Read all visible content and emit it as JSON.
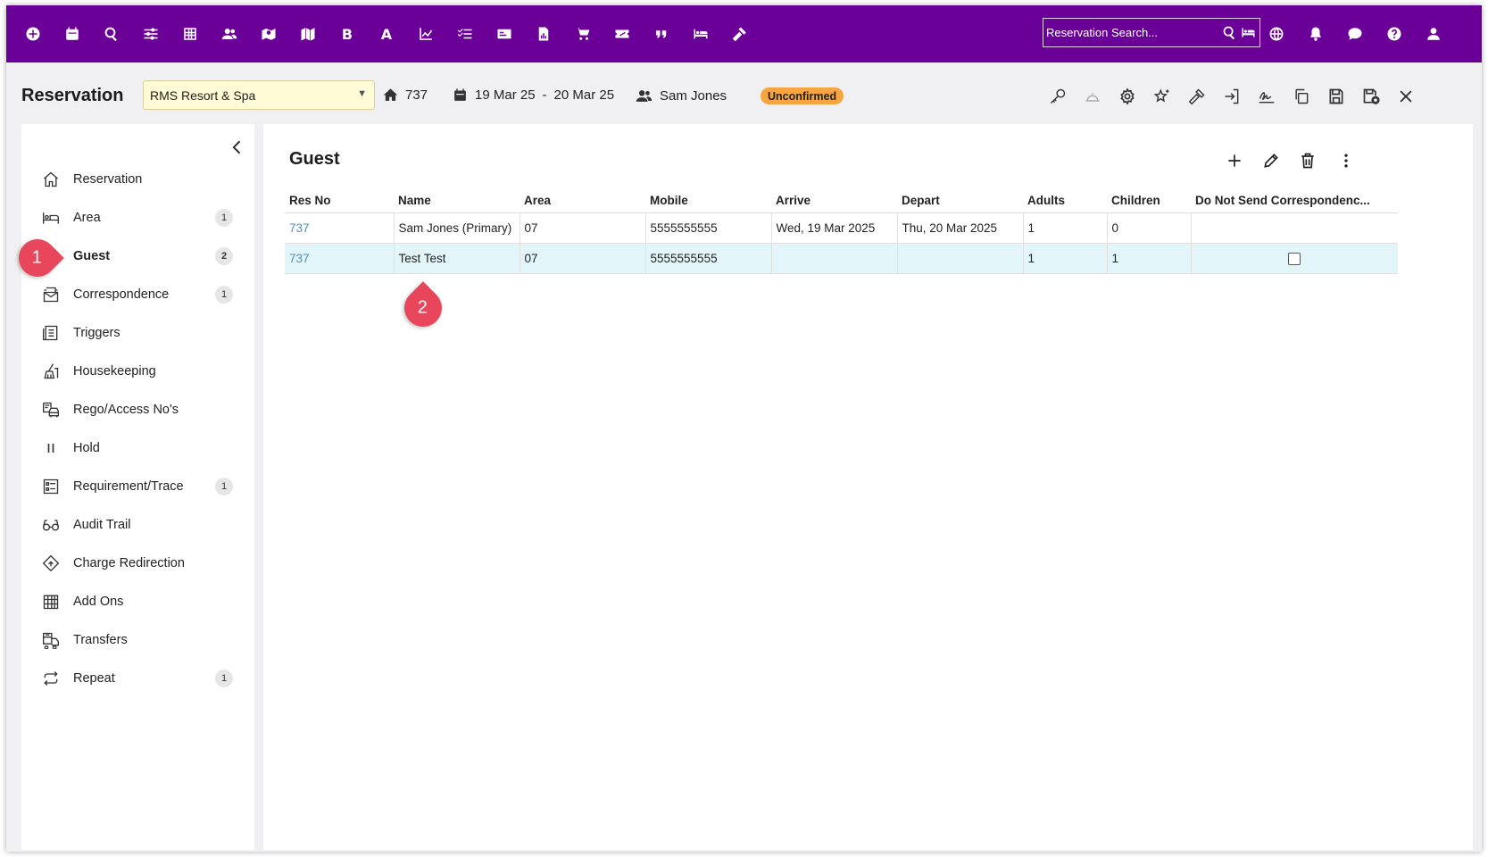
{
  "topbar": {
    "icons": [
      "add-circle-icon",
      "calendar-icon",
      "search-icon",
      "sliders-icon",
      "grid-icon",
      "users-icon",
      "map-pin-icon",
      "map-icon",
      "bold-b-icon",
      "letter-a-icon",
      "line-chart-icon",
      "checklist-icon",
      "card-icon",
      "report-icon",
      "cart-icon",
      "ticket-icon",
      "quote-icon",
      "bed-icon",
      "gavel-icon"
    ],
    "letter_b": "B",
    "letter_a": "A",
    "search_placeholder": "Reservation Search...",
    "right_icons": [
      "globe-icon",
      "bell-icon",
      "chat-icon",
      "help-icon",
      "user-icon"
    ]
  },
  "header": {
    "title": "Reservation",
    "property": "RMS Resort & Spa",
    "room": "737",
    "date_from": "19 Mar 25",
    "date_sep": "-",
    "date_to": "20 Mar 25",
    "guest_name": "Sam Jones",
    "status": "Unconfirmed",
    "status_color": "#f6a540",
    "actions": [
      "key-icon",
      "bell-service-icon",
      "gear-icon",
      "stars-icon",
      "hammer-icon",
      "sign-in-icon",
      "signature-icon",
      "copy-icon",
      "save-icon",
      "save-close-icon",
      "close-icon"
    ]
  },
  "sidebar": {
    "items": [
      {
        "label": "Reservation",
        "icon": "home-icon",
        "count": ""
      },
      {
        "label": "Area",
        "icon": "bed-icon",
        "count": "1"
      },
      {
        "label": "Guest",
        "icon": "user-icon",
        "count": "2",
        "active": true
      },
      {
        "label": "Correspondence",
        "icon": "mail-stack-icon",
        "count": "1"
      },
      {
        "label": "Triggers",
        "icon": "list-icon",
        "count": ""
      },
      {
        "label": "Housekeeping",
        "icon": "mop-icon",
        "count": ""
      },
      {
        "label": "Rego/Access No's",
        "icon": "car-icon",
        "count": ""
      },
      {
        "label": "Hold",
        "icon": "pause-icon",
        "count": ""
      },
      {
        "label": "Requirement/Trace",
        "icon": "checklist-icon",
        "count": "1"
      },
      {
        "label": "Audit Trail",
        "icon": "glasses-icon",
        "count": ""
      },
      {
        "label": "Charge Redirection",
        "icon": "diamond-icon",
        "count": ""
      },
      {
        "label": "Add Ons",
        "icon": "calendar-grid-icon",
        "count": ""
      },
      {
        "label": "Transfers",
        "icon": "bus-icon",
        "count": ""
      },
      {
        "label": "Repeat",
        "icon": "repeat-icon",
        "count": "1"
      }
    ]
  },
  "main": {
    "title": "Guest",
    "columns": [
      "Res No",
      "Name",
      "Area",
      "Mobile",
      "Arrive",
      "Depart",
      "Adults",
      "Children",
      "Do Not Send Correspondenc..."
    ],
    "rows": [
      {
        "res_no": "737",
        "name": "Sam Jones (Primary)",
        "area": "07",
        "mobile": "5555555555",
        "arrive": "Wed, 19 Mar 2025",
        "depart": "Thu, 20 Mar 2025",
        "adults": "1",
        "children": "0",
        "no_corr": null
      },
      {
        "res_no": "737",
        "name": "Test Test",
        "area": "07",
        "mobile": "5555555555",
        "arrive": "",
        "depart": "",
        "adults": "1",
        "children": "1",
        "no_corr": false,
        "selected": true
      }
    ]
  },
  "callouts": {
    "one": "1",
    "two": "2"
  }
}
